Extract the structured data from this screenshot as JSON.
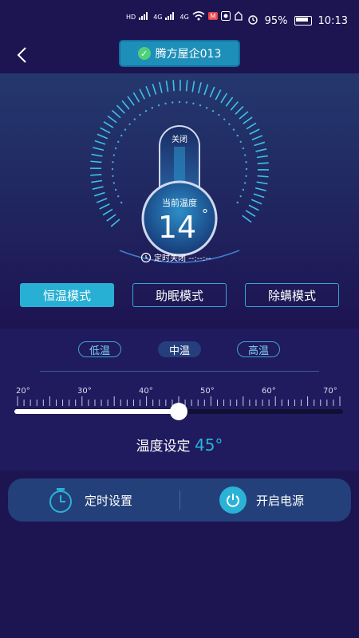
{
  "status_bar": {
    "net_labels": [
      "HD",
      "4G",
      "4G"
    ],
    "battery": "95%",
    "time": "10:13"
  },
  "header": {
    "device_name": "腾方屋企013"
  },
  "gauge": {
    "switch_state": "关闭",
    "current_temp_label": "当前温度",
    "current_temp": "14",
    "degree_symbol": "°",
    "timer_text": "定时关闭 --:--:--"
  },
  "modes": [
    {
      "label": "恒温模式",
      "active": true
    },
    {
      "label": "助眠模式",
      "active": false
    },
    {
      "label": "除螨模式",
      "active": false
    }
  ],
  "levels": [
    {
      "label": "低温",
      "active": false
    },
    {
      "label": "中温",
      "active": true
    },
    {
      "label": "高温",
      "active": false
    }
  ],
  "slider": {
    "tick_labels": [
      "20°",
      "30°",
      "40°",
      "50°",
      "60°",
      "70°"
    ],
    "min": 20,
    "max": 70,
    "value": 45
  },
  "setting": {
    "label": "温度设定",
    "value": "45°"
  },
  "bottom_bar": {
    "timer_label": "定时设置",
    "power_label": "开启电源"
  },
  "colors": {
    "background": "#1d1452",
    "accent": "#28b0d4",
    "panel": "#201a5e",
    "bottom_bar": "#23407a"
  }
}
